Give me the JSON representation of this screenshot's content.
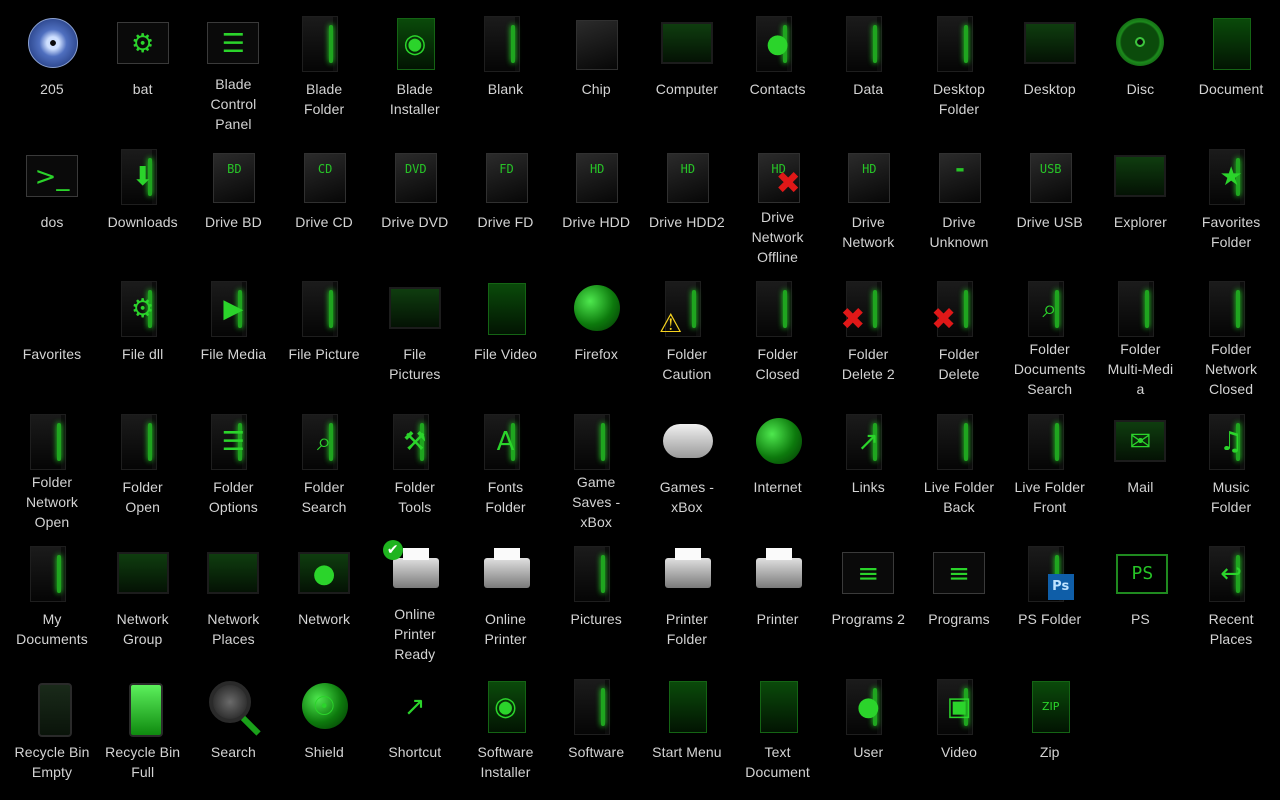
{
  "colors": {
    "background": "#000000",
    "label": "#d4d4d4",
    "accent": "#22c422"
  },
  "icons": [
    {
      "label": "205",
      "icon": "blue-disc-icon",
      "art": "bluedisc"
    },
    {
      "label": "bat",
      "icon": "gear-window-icon",
      "art": "window",
      "glyph": "⚙"
    },
    {
      "label": "Blade\nControl\nPanel",
      "icon": "control-panel-icon",
      "art": "window",
      "glyph": "☰"
    },
    {
      "label": "Blade\nFolder",
      "icon": "folder-icon",
      "art": "folder"
    },
    {
      "label": "Blade\nInstaller",
      "icon": "installer-icon",
      "art": "paper",
      "glyph": "◉"
    },
    {
      "label": "Blank",
      "icon": "blank-file-icon",
      "art": "folder"
    },
    {
      "label": "Chip",
      "icon": "chip-icon",
      "art": "drive"
    },
    {
      "label": "Computer",
      "icon": "computer-monitor-icon",
      "art": "panel"
    },
    {
      "label": "Contacts",
      "icon": "contacts-icon",
      "art": "folder",
      "glyph": "●"
    },
    {
      "label": "Data",
      "icon": "data-folder-icon",
      "art": "folder"
    },
    {
      "label": "Desktop\nFolder",
      "icon": "desktop-folder-icon",
      "art": "folder"
    },
    {
      "label": "Desktop",
      "icon": "desktop-icon",
      "art": "panel"
    },
    {
      "label": "Disc",
      "icon": "green-disc-icon",
      "art": "disc"
    },
    {
      "label": "Document",
      "icon": "document-icon",
      "art": "paper"
    },
    {
      "label": "dos",
      "icon": "terminal-icon",
      "art": "window",
      "glyph": ">_"
    },
    {
      "label": "Downloads",
      "icon": "downloads-folder-icon",
      "art": "folder",
      "glyph": "⬇"
    },
    {
      "label": "Drive BD",
      "icon": "drive-bd-icon",
      "art": "drive",
      "text": "BD"
    },
    {
      "label": "Drive CD",
      "icon": "drive-cd-icon",
      "art": "drive",
      "text": "CD"
    },
    {
      "label": "Drive DVD",
      "icon": "drive-dvd-icon",
      "art": "drive",
      "text": "DVD"
    },
    {
      "label": "Drive FD",
      "icon": "drive-fd-icon",
      "art": "drive",
      "text": "FD"
    },
    {
      "label": "Drive HDD",
      "icon": "drive-hdd-icon",
      "art": "drive",
      "text": "HD"
    },
    {
      "label": "Drive HDD2",
      "icon": "drive-hdd2-icon",
      "art": "drive",
      "text": "HD"
    },
    {
      "label": "Drive\nNetwork\nOffline",
      "icon": "drive-network-offline-icon",
      "art": "drive",
      "text": "HD",
      "x": true
    },
    {
      "label": "Drive\nNetwork",
      "icon": "drive-network-icon",
      "art": "drive",
      "text": "HD"
    },
    {
      "label": "Drive\nUnknown",
      "icon": "drive-unknown-icon",
      "art": "drive",
      "text": "▬"
    },
    {
      "label": "Drive USB",
      "icon": "drive-usb-icon",
      "art": "drive",
      "text": "USB"
    },
    {
      "label": "Explorer",
      "icon": "explorer-windows-icon",
      "art": "panel"
    },
    {
      "label": "Favorites\nFolder",
      "icon": "favorites-folder-icon",
      "art": "folder",
      "glyph": "★"
    },
    {
      "label": "Favorites",
      "icon": "star-icon",
      "art": "star"
    },
    {
      "label": "File dll",
      "icon": "file-dll-icon",
      "art": "folder",
      "glyph": "⚙"
    },
    {
      "label": "File Media",
      "icon": "file-media-icon",
      "art": "folder",
      "glyph": "▶"
    },
    {
      "label": "File Picture",
      "icon": "file-picture-icon",
      "art": "folder"
    },
    {
      "label": "File\nPictures",
      "icon": "file-pictures-icon",
      "art": "panel"
    },
    {
      "label": "File Video",
      "icon": "file-video-icon",
      "art": "paper"
    },
    {
      "label": "Firefox",
      "icon": "firefox-icon",
      "art": "globe"
    },
    {
      "label": "Folder\nCaution",
      "icon": "folder-caution-icon",
      "art": "folder",
      "warn": true
    },
    {
      "label": "Folder\nClosed",
      "icon": "folder-closed-icon",
      "art": "folder"
    },
    {
      "label": "Folder\nDelete 2",
      "icon": "folder-delete2-icon",
      "art": "folder",
      "x": true
    },
    {
      "label": "Folder\nDelete",
      "icon": "folder-delete-icon",
      "art": "folder",
      "x": true
    },
    {
      "label": "Folder\nDocuments\nSearch",
      "icon": "folder-documents-search-icon",
      "art": "folder",
      "glyph": "⌕"
    },
    {
      "label": "Folder\nMulti-Medi\na",
      "icon": "folder-multimedia-icon",
      "art": "folder"
    },
    {
      "label": "Folder\nNetwork\nClosed",
      "icon": "folder-network-closed-icon",
      "art": "folder"
    },
    {
      "label": "Folder\nNetwork\nOpen",
      "icon": "folder-network-open-icon",
      "art": "folder"
    },
    {
      "label": "Folder\nOpen",
      "icon": "folder-open-icon",
      "art": "folder"
    },
    {
      "label": "Folder\nOptions",
      "icon": "folder-options-icon",
      "art": "folder",
      "glyph": "☰"
    },
    {
      "label": "Folder\nSearch",
      "icon": "folder-search-icon",
      "art": "folder",
      "glyph": "⌕"
    },
    {
      "label": "Folder\nTools",
      "icon": "folder-tools-icon",
      "art": "folder",
      "glyph": "⚒"
    },
    {
      "label": "Fonts\nFolder",
      "icon": "fonts-folder-icon",
      "art": "folder",
      "glyph": "A"
    },
    {
      "label": "Game\nSaves -\nxBox",
      "icon": "game-saves-icon",
      "art": "folder"
    },
    {
      "label": "Games -\nxBox",
      "icon": "gamepad-icon",
      "art": "gamepad"
    },
    {
      "label": "Internet",
      "icon": "globe-icon",
      "art": "globe"
    },
    {
      "label": "Links",
      "icon": "links-folder-icon",
      "art": "folder",
      "glyph": "↗"
    },
    {
      "label": "Live Folder\nBack",
      "icon": "live-folder-back-icon",
      "art": "folder"
    },
    {
      "label": "Live Folder\nFront",
      "icon": "live-folder-front-icon",
      "art": "folder"
    },
    {
      "label": "Mail",
      "icon": "mail-icon",
      "art": "panel",
      "glyph": "✉"
    },
    {
      "label": "Music\nFolder",
      "icon": "music-folder-icon",
      "art": "folder",
      "glyph": "♫"
    },
    {
      "label": "My\nDocuments",
      "icon": "my-documents-icon",
      "art": "folder"
    },
    {
      "label": "Network\nGroup",
      "icon": "network-group-icon",
      "art": "panel"
    },
    {
      "label": "Network\nPlaces",
      "icon": "network-places-icon",
      "art": "panel"
    },
    {
      "label": "Network",
      "icon": "network-icon",
      "art": "panel",
      "glyph": "●"
    },
    {
      "label": "Online\nPrinter\nReady",
      "icon": "printer-ready-icon",
      "art": "printer",
      "check": true
    },
    {
      "label": "Online\nPrinter",
      "icon": "online-printer-icon",
      "art": "printer"
    },
    {
      "label": "Pictures",
      "icon": "pictures-folder-icon",
      "art": "folder"
    },
    {
      "label": "Printer\nFolder",
      "icon": "printer-folder-icon",
      "art": "printer"
    },
    {
      "label": "Printer",
      "icon": "printer-icon",
      "art": "printer"
    },
    {
      "label": "Programs 2",
      "icon": "programs2-window-icon",
      "art": "window",
      "glyph": "≡"
    },
    {
      "label": "Programs",
      "icon": "programs-window-icon",
      "art": "window",
      "glyph": "≡"
    },
    {
      "label": "PS Folder",
      "icon": "ps-folder-icon",
      "art": "folder",
      "ps": "Ps"
    },
    {
      "label": "PS",
      "icon": "ps-icon",
      "art": "psbig",
      "text": "PS"
    },
    {
      "label": "Recent\nPlaces",
      "icon": "recent-places-icon",
      "art": "folder",
      "glyph": "↩"
    },
    {
      "label": "Recycle Bin\nEmpty",
      "icon": "recycle-bin-empty-icon",
      "art": "bin",
      "fill": "empty"
    },
    {
      "label": "Recycle Bin\nFull",
      "icon": "recycle-bin-full-icon",
      "art": "bin",
      "fill": "full"
    },
    {
      "label": "Search",
      "icon": "search-icon",
      "art": "magnifier"
    },
    {
      "label": "Shield",
      "icon": "shield-icon",
      "art": "globe",
      "glyph": "☉"
    },
    {
      "label": "Shortcut",
      "icon": "shortcut-arrow-icon",
      "art": "glyph",
      "glyph": "↗"
    },
    {
      "label": "Software\nInstaller",
      "icon": "software-installer-icon",
      "art": "paper",
      "glyph": "◉"
    },
    {
      "label": "Software",
      "icon": "software-folder-icon",
      "art": "folder"
    },
    {
      "label": "Start Menu",
      "icon": "start-menu-icon",
      "art": "paper"
    },
    {
      "label": "Text\nDocument",
      "icon": "text-document-icon",
      "art": "paper"
    },
    {
      "label": "User",
      "icon": "user-icon",
      "art": "folder",
      "glyph": "●"
    },
    {
      "label": "Video",
      "icon": "video-camera-icon",
      "art": "folder",
      "glyph": "▣"
    },
    {
      "label": "Zip",
      "icon": "zip-icon",
      "art": "paper",
      "text": "ZIP"
    }
  ]
}
